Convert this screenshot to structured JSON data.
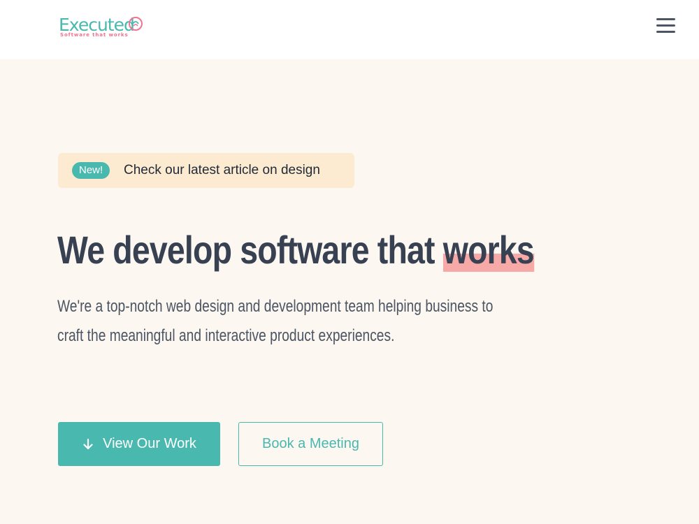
{
  "header": {
    "logo_text": "Executed",
    "logo_tagline": "Software that works",
    "menu_icon": "hamburger-menu-icon"
  },
  "announcement": {
    "badge": "New!",
    "text": "Check our latest article on design"
  },
  "hero": {
    "headline_main": "We develop software that ",
    "headline_highlight": "works",
    "description": "We're a top-notch web design and development team helping business to craft the meaningful and interactive product experiences."
  },
  "actions": {
    "primary_label": "View Our Work",
    "primary_icon": "arrow-down-icon",
    "secondary_label": "Book a Meeting"
  },
  "colors": {
    "accent": "#49b8ae",
    "highlight": "#f6a9a6",
    "background": "#fdf7f1",
    "badge_background": "#fdebd1",
    "text_dark": "#374151"
  }
}
